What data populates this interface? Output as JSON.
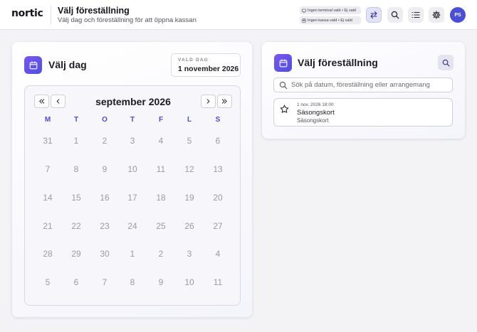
{
  "header": {
    "logo": "nortic",
    "title": "Välj föreställning",
    "subtitle": "Välj dag och föreställning för att öppna kassan",
    "status_terminal": "Ingen terminal vald • Ej vald",
    "status_register": "Ingen kassa vald • Ej vald",
    "avatar_initials": "PS",
    "buttons": [
      "swap-icon",
      "search-icon",
      "list-icon",
      "gear-icon"
    ]
  },
  "day_panel": {
    "title": "Välj dag",
    "selected_label": "VALD DAG",
    "selected_value": "1 november 2026",
    "calendar": {
      "month": "september 2026",
      "weekdays": [
        "M",
        "T",
        "O",
        "T",
        "F",
        "L",
        "S"
      ],
      "weeks": [
        [
          "31",
          "1",
          "2",
          "3",
          "4",
          "5",
          "6"
        ],
        [
          "7",
          "8",
          "9",
          "10",
          "11",
          "12",
          "13"
        ],
        [
          "14",
          "15",
          "16",
          "17",
          "18",
          "19",
          "20"
        ],
        [
          "21",
          "22",
          "23",
          "24",
          "25",
          "26",
          "27"
        ],
        [
          "28",
          "29",
          "30",
          "1",
          "2",
          "3",
          "4"
        ],
        [
          "5",
          "6",
          "7",
          "8",
          "9",
          "10",
          "11"
        ]
      ]
    }
  },
  "performance_panel": {
    "title": "Välj föreställning",
    "search_placeholder": "Sök på datum, föreställning eller arrangemang",
    "items": [
      {
        "datetime": "1 nov. 2026 18:00",
        "name": "Säsongskort",
        "organizer": "Säsongskort",
        "icon": "star-icon"
      }
    ]
  },
  "colors": {
    "accent": "#4b4ed6",
    "accent_gradient_start": "#7a56f0",
    "muted_day": "#9b9ba6"
  }
}
